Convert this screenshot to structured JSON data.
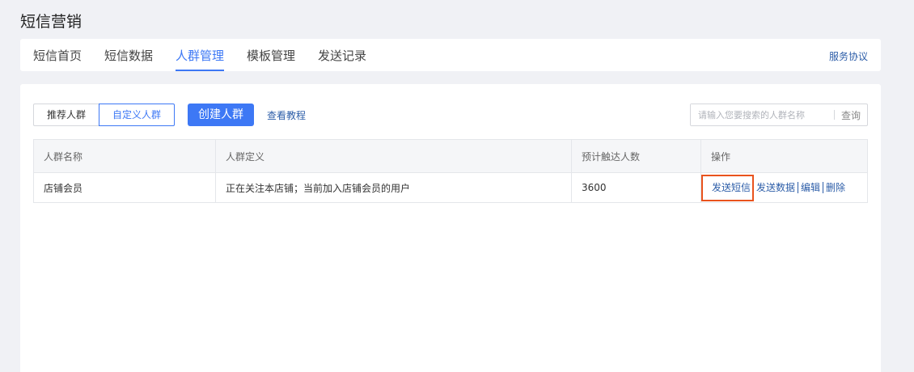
{
  "page": {
    "title": "短信营销"
  },
  "tabs": [
    {
      "label": "短信首页",
      "active": false
    },
    {
      "label": "短信数据",
      "active": false
    },
    {
      "label": "人群管理",
      "active": true
    },
    {
      "label": "模板管理",
      "active": false
    },
    {
      "label": "发送记录",
      "active": false
    }
  ],
  "header": {
    "service_link": "服务协议"
  },
  "toolbar": {
    "segments": [
      {
        "label": "推荐人群",
        "selected": false
      },
      {
        "label": "自定义人群",
        "selected": true
      }
    ],
    "create_label": "创建人群",
    "tutorial_label": "查看教程",
    "search_placeholder": "请输入您要搜索的人群名称",
    "search_button": "查询"
  },
  "table": {
    "columns": [
      "人群名称",
      "人群定义",
      "预计触达人数",
      "操作"
    ],
    "rows": [
      {
        "name": "店铺会员",
        "definition": "正在关注本店铺；当前加入店铺会员的用户",
        "reach": "3600",
        "actions": [
          "发送短信",
          "发送数据",
          "编辑",
          "删除"
        ]
      }
    ]
  },
  "colors": {
    "accent": "#3d78f5",
    "link": "#2c5da8",
    "highlight": "#e9531d"
  }
}
